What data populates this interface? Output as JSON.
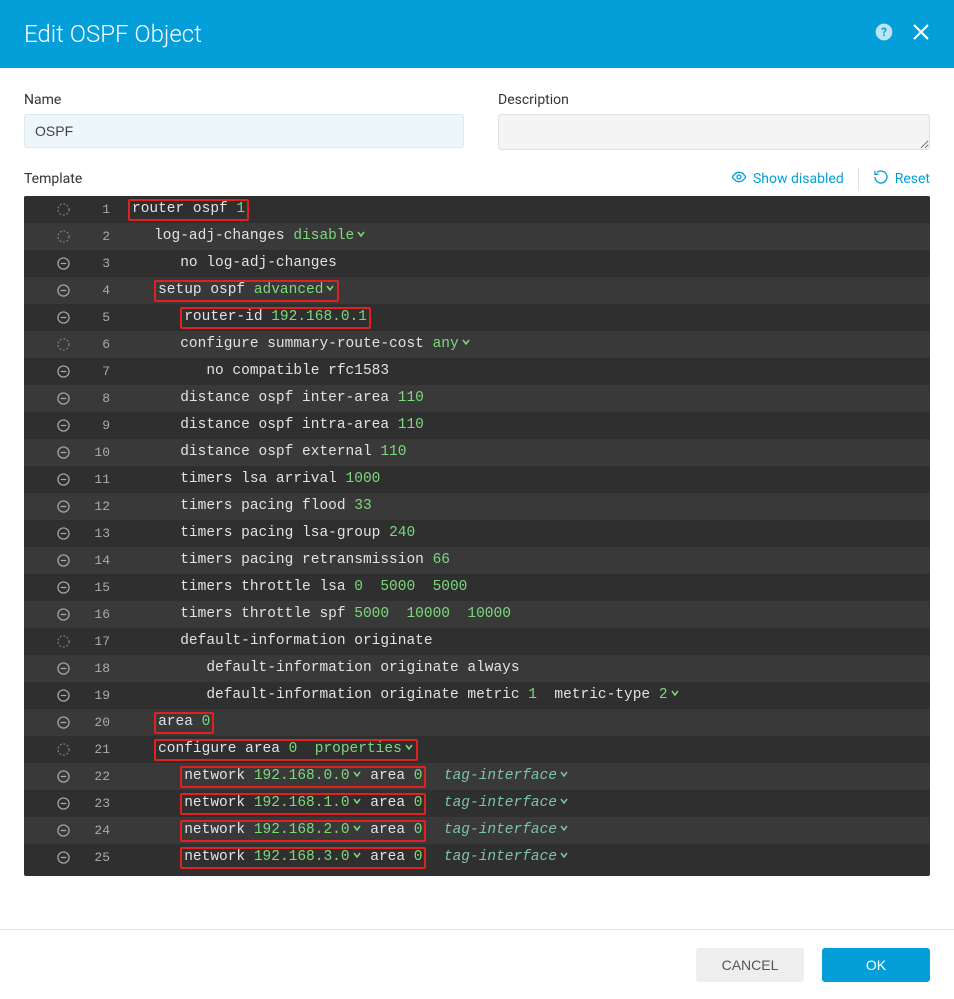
{
  "header": {
    "title": "Edit OSPF Object"
  },
  "form": {
    "name_label": "Name",
    "name_value": "OSPF",
    "desc_label": "Description",
    "desc_value": ""
  },
  "template": {
    "label": "Template",
    "show_disabled": "Show disabled",
    "reset": "Reset"
  },
  "footer": {
    "cancel": "CANCEL",
    "ok": "OK"
  },
  "lines": [
    {
      "n": 1,
      "icon": "dash",
      "indent": 0,
      "hl": true,
      "segs": [
        {
          "t": "router ospf ",
          "c": "w"
        },
        {
          "t": "1",
          "c": "g"
        }
      ]
    },
    {
      "n": 2,
      "icon": "dash",
      "indent": 1,
      "hl": false,
      "segs": [
        {
          "t": "log-adj-changes ",
          "c": "w"
        },
        {
          "t": "disable",
          "c": "g",
          "chev": true
        }
      ]
    },
    {
      "n": 3,
      "icon": "minus",
      "indent": 2,
      "hl": false,
      "segs": [
        {
          "t": "no log-adj-changes",
          "c": "w"
        }
      ]
    },
    {
      "n": 4,
      "icon": "minus",
      "indent": 1,
      "hl": true,
      "segs": [
        {
          "t": "setup ospf ",
          "c": "w"
        },
        {
          "t": "advanced",
          "c": "g",
          "chev": true
        }
      ]
    },
    {
      "n": 5,
      "icon": "minus",
      "indent": 2,
      "hl": true,
      "segs": [
        {
          "t": "router-id ",
          "c": "w"
        },
        {
          "t": "192.168.0.1",
          "c": "g"
        }
      ]
    },
    {
      "n": 6,
      "icon": "dash",
      "indent": 2,
      "hl": false,
      "segs": [
        {
          "t": "configure summary-route-cost ",
          "c": "w"
        },
        {
          "t": "any",
          "c": "g",
          "chev": true
        }
      ]
    },
    {
      "n": 7,
      "icon": "minus",
      "indent": 3,
      "hl": false,
      "segs": [
        {
          "t": "no compatible rfc1583",
          "c": "w"
        }
      ]
    },
    {
      "n": 8,
      "icon": "minus",
      "indent": 2,
      "hl": false,
      "segs": [
        {
          "t": "distance ospf inter-area ",
          "c": "w"
        },
        {
          "t": "110",
          "c": "g"
        }
      ]
    },
    {
      "n": 9,
      "icon": "minus",
      "indent": 2,
      "hl": false,
      "segs": [
        {
          "t": "distance ospf intra-area ",
          "c": "w"
        },
        {
          "t": "110",
          "c": "g"
        }
      ]
    },
    {
      "n": 10,
      "icon": "minus",
      "indent": 2,
      "hl": false,
      "segs": [
        {
          "t": "distance ospf external ",
          "c": "w"
        },
        {
          "t": "110",
          "c": "g"
        }
      ]
    },
    {
      "n": 11,
      "icon": "minus",
      "indent": 2,
      "hl": false,
      "segs": [
        {
          "t": "timers lsa arrival ",
          "c": "w"
        },
        {
          "t": "1000",
          "c": "g"
        }
      ]
    },
    {
      "n": 12,
      "icon": "minus",
      "indent": 2,
      "hl": false,
      "segs": [
        {
          "t": "timers pacing flood ",
          "c": "w"
        },
        {
          "t": "33",
          "c": "g"
        }
      ]
    },
    {
      "n": 13,
      "icon": "minus",
      "indent": 2,
      "hl": false,
      "segs": [
        {
          "t": "timers pacing lsa-group ",
          "c": "w"
        },
        {
          "t": "240",
          "c": "g"
        }
      ]
    },
    {
      "n": 14,
      "icon": "minus",
      "indent": 2,
      "hl": false,
      "segs": [
        {
          "t": "timers pacing retransmission ",
          "c": "w"
        },
        {
          "t": "66",
          "c": "g"
        }
      ]
    },
    {
      "n": 15,
      "icon": "minus",
      "indent": 2,
      "hl": false,
      "segs": [
        {
          "t": "timers throttle lsa ",
          "c": "w"
        },
        {
          "t": "0",
          "c": "g"
        },
        {
          "t": "  ",
          "c": "w"
        },
        {
          "t": "5000",
          "c": "g"
        },
        {
          "t": "  ",
          "c": "w"
        },
        {
          "t": "5000",
          "c": "g"
        }
      ]
    },
    {
      "n": 16,
      "icon": "minus",
      "indent": 2,
      "hl": false,
      "segs": [
        {
          "t": "timers throttle spf ",
          "c": "w"
        },
        {
          "t": "5000",
          "c": "g"
        },
        {
          "t": "  ",
          "c": "w"
        },
        {
          "t": "10000",
          "c": "g"
        },
        {
          "t": "  ",
          "c": "w"
        },
        {
          "t": "10000",
          "c": "g"
        }
      ]
    },
    {
      "n": 17,
      "icon": "dash",
      "indent": 2,
      "hl": false,
      "segs": [
        {
          "t": "default-information originate",
          "c": "w"
        }
      ]
    },
    {
      "n": 18,
      "icon": "minus",
      "indent": 3,
      "hl": false,
      "segs": [
        {
          "t": "default-information originate always",
          "c": "w"
        }
      ]
    },
    {
      "n": 19,
      "icon": "minus",
      "indent": 3,
      "hl": false,
      "segs": [
        {
          "t": "default-information originate metric ",
          "c": "w"
        },
        {
          "t": "1",
          "c": "g"
        },
        {
          "t": "  metric-type ",
          "c": "w"
        },
        {
          "t": "2",
          "c": "g",
          "chev": true
        }
      ]
    },
    {
      "n": 20,
      "icon": "minus",
      "indent": 1,
      "hl": true,
      "segs": [
        {
          "t": "area ",
          "c": "w"
        },
        {
          "t": "0",
          "c": "g"
        }
      ]
    },
    {
      "n": 21,
      "icon": "dash",
      "indent": 1,
      "hl": true,
      "segs": [
        {
          "t": "configure area ",
          "c": "w"
        },
        {
          "t": "0",
          "c": "g"
        },
        {
          "t": "  ",
          "c": "w"
        },
        {
          "t": "properties",
          "c": "g",
          "chev": true
        }
      ]
    },
    {
      "n": 22,
      "icon": "minus",
      "indent": 2,
      "hl": true,
      "trail": "tag-interface",
      "segs": [
        {
          "t": "network ",
          "c": "w"
        },
        {
          "t": "192.168.0.0",
          "c": "g",
          "chev": true
        },
        {
          "t": " area ",
          "c": "w"
        },
        {
          "t": "0",
          "c": "g"
        }
      ]
    },
    {
      "n": 23,
      "icon": "minus",
      "indent": 2,
      "hl": true,
      "trail": "tag-interface",
      "segs": [
        {
          "t": "network ",
          "c": "w"
        },
        {
          "t": "192.168.1.0",
          "c": "g",
          "chev": true
        },
        {
          "t": " area ",
          "c": "w"
        },
        {
          "t": "0",
          "c": "g"
        }
      ]
    },
    {
      "n": 24,
      "icon": "minus",
      "indent": 2,
      "hl": true,
      "trail": "tag-interface",
      "segs": [
        {
          "t": "network ",
          "c": "w"
        },
        {
          "t": "192.168.2.0",
          "c": "g",
          "chev": true
        },
        {
          "t": " area ",
          "c": "w"
        },
        {
          "t": "0",
          "c": "g"
        }
      ]
    },
    {
      "n": 25,
      "icon": "minus",
      "indent": 2,
      "hl": true,
      "trail": "tag-interface",
      "segs": [
        {
          "t": "network ",
          "c": "w"
        },
        {
          "t": "192.168.3.0",
          "c": "g",
          "chev": true
        },
        {
          "t": " area ",
          "c": "w"
        },
        {
          "t": "0",
          "c": "g"
        }
      ]
    }
  ]
}
